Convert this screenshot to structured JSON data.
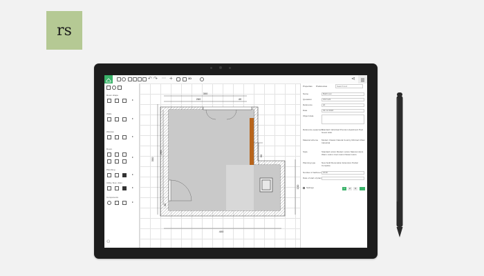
{
  "brand": {
    "logo_text": "rs",
    "logo_color": "#b5c994"
  },
  "app": {
    "accent_color": "#3bb36a",
    "toolbar_icons": [
      "home-icon",
      "settings-icon",
      "layers-icon",
      "save-icon",
      "open-icon",
      "print-icon",
      "export-icon",
      "undo-icon",
      "redo-icon",
      "cursor-icon",
      "add-icon",
      "camera-icon",
      "monitor-icon",
      "3d-view-icon",
      "help-icon",
      "share-icon",
      "menu-icon"
    ],
    "sidebar": {
      "sections": [
        {
          "label": "Room shape"
        },
        {
          "label": "Walls"
        },
        {
          "label": "Window"
        },
        {
          "label": "Doors"
        },
        {
          "label": "Plumbing"
        },
        {
          "label": "Utility, floor, drain"
        },
        {
          "label": "Components"
        }
      ]
    },
    "plan": {
      "dimensions": {
        "top": "300",
        "left_outer": "300",
        "left_inner": "260",
        "top_right": "40",
        "right_outer": "100",
        "bottom": "400",
        "mid_right": "60",
        "inner_small": "30"
      }
    },
    "panel": {
      "tabs": [
        "Properties",
        "Preferences"
      ],
      "search_placeholder": "Search text",
      "rows": [
        {
          "label": "Name",
          "value": "Bathroom"
        },
        {
          "label": "Quotation",
          "value": "KNY123"
        },
        {
          "label": "Reference",
          "value": "ab"
        },
        {
          "label": "Date",
          "value": "03.12.2018"
        },
        {
          "label": "Object data",
          "value": ""
        }
      ],
      "check_groups": [
        {
          "label": "Reference equipment",
          "options": [
            "Standard",
            "Individual",
            "Premium",
            "Apartment",
            "Pool",
            "Guest toilet"
          ]
        },
        {
          "label": "Material scheme",
          "options": [
            "Modern",
            "Classic",
            "Natural",
            "Country",
            "Minimal",
            "Urban",
            "Industrial"
          ]
        },
        {
          "label": "Style",
          "options": [
            "Standard colors",
            "Modern colors",
            "Natural colors",
            "Warm colors",
            "Cool colors",
            "Pastel colors"
          ]
        },
        {
          "label": "Planning type",
          "options": [
            "New build",
            "Renovation",
            "Extension",
            "Partial",
            "Complete"
          ]
        }
      ],
      "extra_rows": [
        {
          "label": "Number of bathrooms",
          "value": "2018"
        },
        {
          "label": "Date of start of planning",
          "value": ""
        }
      ],
      "footer_label": "Settings",
      "pages": [
        "1",
        "2",
        "3"
      ]
    }
  }
}
